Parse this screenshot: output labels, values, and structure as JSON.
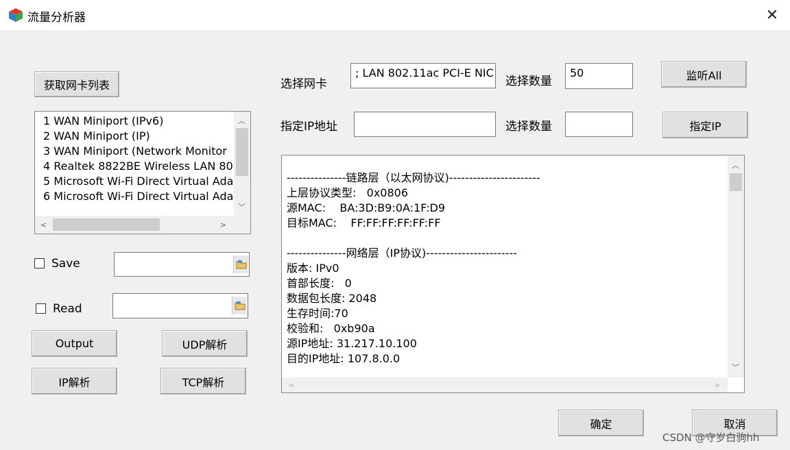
{
  "window": {
    "title": "流量分析器",
    "close_glyph": "✕"
  },
  "left": {
    "get_nic_button": "获取网卡列表",
    "nic_list": [
      "1 WAN Miniport (IPv6)",
      "2 WAN Miniport (IP)",
      "3 WAN Miniport (Network Monitor",
      "4 Realtek 8822BE Wireless LAN 80",
      "5 Microsoft Wi-Fi Direct Virtual Ada",
      "6 Microsoft Wi-Fi Direct Virtual Ada"
    ],
    "save_label": "Save",
    "read_label": "Read",
    "save_path": "",
    "read_path": "",
    "output_button": "Output",
    "udp_button": "UDP解析",
    "ip_button": "IP解析",
    "tcp_button": "TCP解析"
  },
  "top": {
    "select_nic_label": "选择网卡",
    "select_nic_value": "; LAN 802.11ac PCI-E NIC",
    "count_label_1": "选择数量",
    "count_value_1": "50",
    "listen_all_button": "监听All",
    "ip_label": "指定IP地址",
    "ip_value": "",
    "count_label_2": "选择数量",
    "count_value_2": "",
    "specify_ip_button": "指定IP"
  },
  "output_lines": [
    "---------------链路层（以太网协议)-----------------------",
    "上层协议类型:   0x0806",
    "源MAC:    BA:3D:B9:0A:1F:D9",
    "目标MAC:    FF:FF:FF:FF:FF:FF",
    "",
    "---------------网络层（IP协议)-----------------------",
    "版本: IPv0",
    "首部长度:   0",
    "数据包长度: 2048",
    "生存时间:70",
    "校验和:   0xb90a",
    "源IP地址: 31.217.10.100",
    "目的IP地址: 107.8.0.0"
  ],
  "footer": {
    "ok_button": "确定",
    "cancel_button": "取消",
    "watermark": "CSDN @守岁白驹hh"
  },
  "icons": {
    "app": "app-cube-icon",
    "browse": "folder-browse-icon"
  }
}
